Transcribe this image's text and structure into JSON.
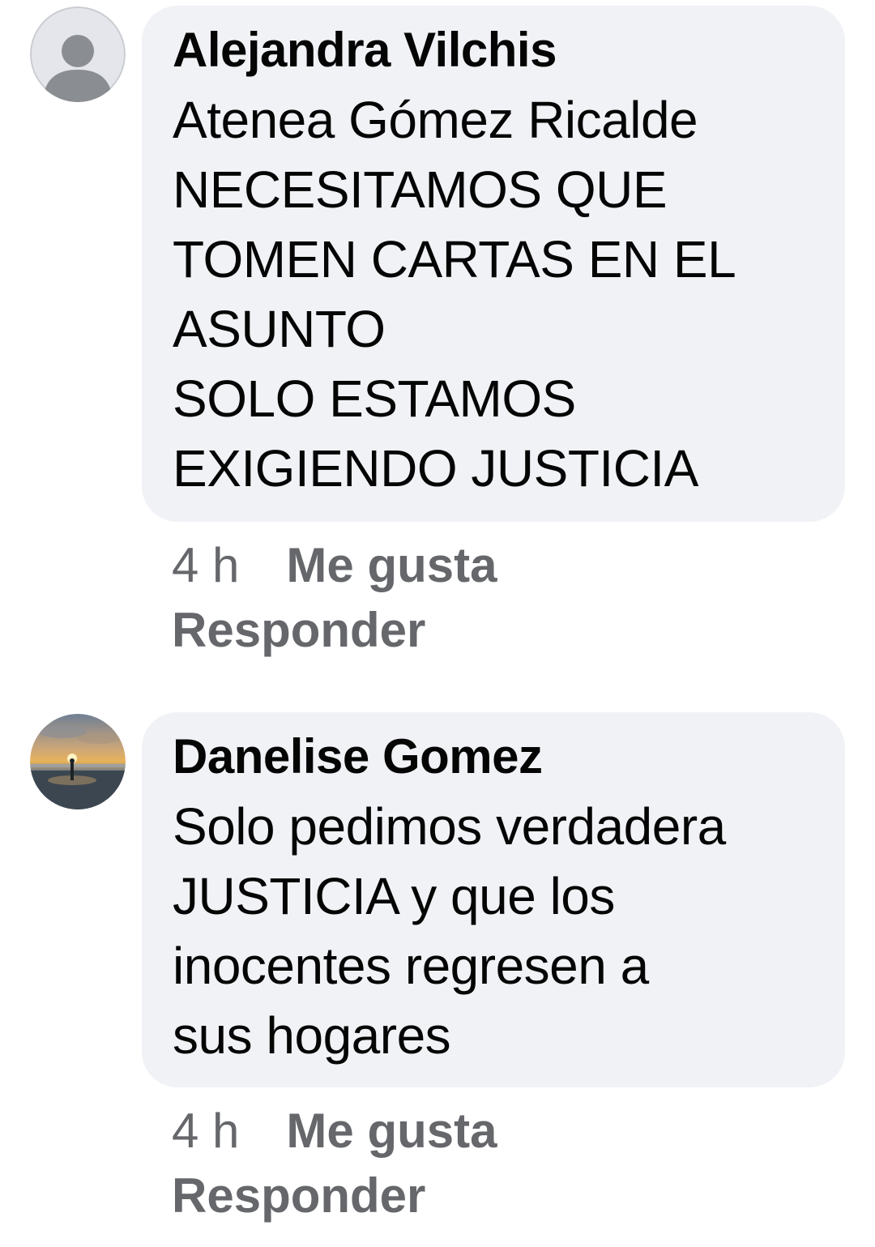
{
  "comments": [
    {
      "author": "Alejandra Vilchis",
      "text": "Atenea Gómez Ricalde\nNECESITAMOS QUE\nTOMEN CARTAS EN EL\nASUNTO\nSOLO ESTAMOS\nEXIGIENDO JUSTICIA",
      "time": "4 h",
      "like_label": "Me gusta",
      "reply_label": "Responder",
      "avatar": "default-profile-icon"
    },
    {
      "author": "Danelise Gomez",
      "text": "Solo pedimos verdadera\nJUSTICIA y que los\ninocentes regresen a\nsus hogares",
      "time": "4 h",
      "like_label": "Me gusta",
      "reply_label": "Responder",
      "avatar": "beach-sunset-photo"
    }
  ],
  "colors": {
    "bubble": "#f0f2f5",
    "text": "#050505",
    "secondary": "#65676b"
  }
}
